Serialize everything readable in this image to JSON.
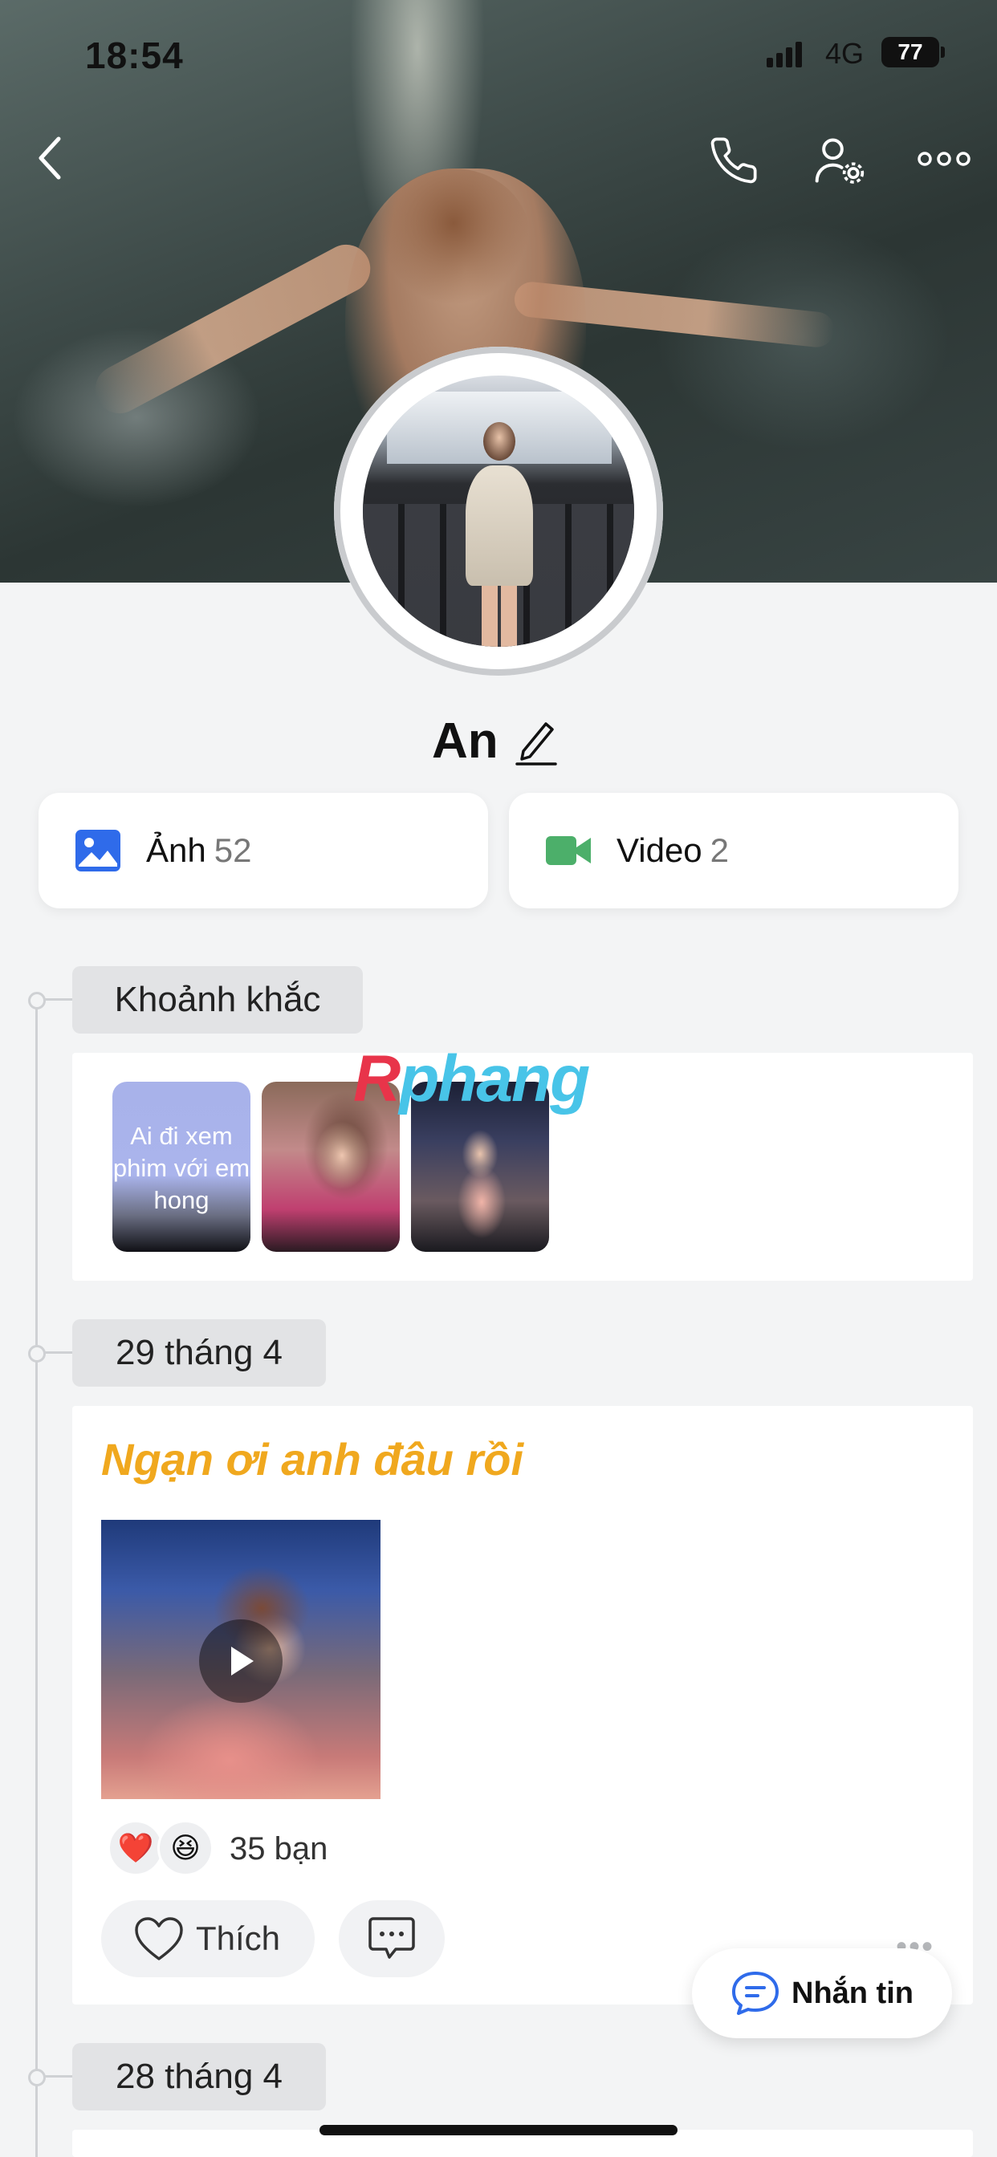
{
  "status_bar": {
    "time": "18:54",
    "network": "4G",
    "battery": "77"
  },
  "header": {
    "back_icon": "chevron-left-icon",
    "call_icon": "phone-icon",
    "settings_icon": "user-settings-icon",
    "more_icon": "more-horizontal-icon"
  },
  "profile": {
    "name": "An",
    "edit_icon": "pencil-icon"
  },
  "media": {
    "photos": {
      "label": "Ảnh",
      "count": "52",
      "icon": "image-icon",
      "color": "#2f6bea"
    },
    "videos": {
      "label": "Video",
      "count": "2",
      "icon": "video-camera-icon",
      "color": "#4caf6a"
    }
  },
  "moments": {
    "title": "Khoảnh khắc",
    "items": [
      {
        "text": "Ai đi xem phim với em hong"
      },
      {
        "text": ""
      },
      {
        "text": ""
      }
    ]
  },
  "watermark": {
    "first": "R",
    "rest": "phang"
  },
  "timeline": [
    {
      "date": "29 tháng 4",
      "post": {
        "title": "Ngạn ơi anh đâu rồi",
        "reactions": [
          "❤️",
          "😆"
        ],
        "reaction_count": "35 bạn",
        "like_label": "Thích"
      }
    },
    {
      "date": "28 tháng 4"
    }
  ],
  "message_button": {
    "label": "Nhắn tin",
    "icon": "chat-bubble-icon",
    "color": "#2f6bea"
  },
  "colors": {
    "accent_title": "#f0a81e",
    "background": "#f3f4f5"
  }
}
